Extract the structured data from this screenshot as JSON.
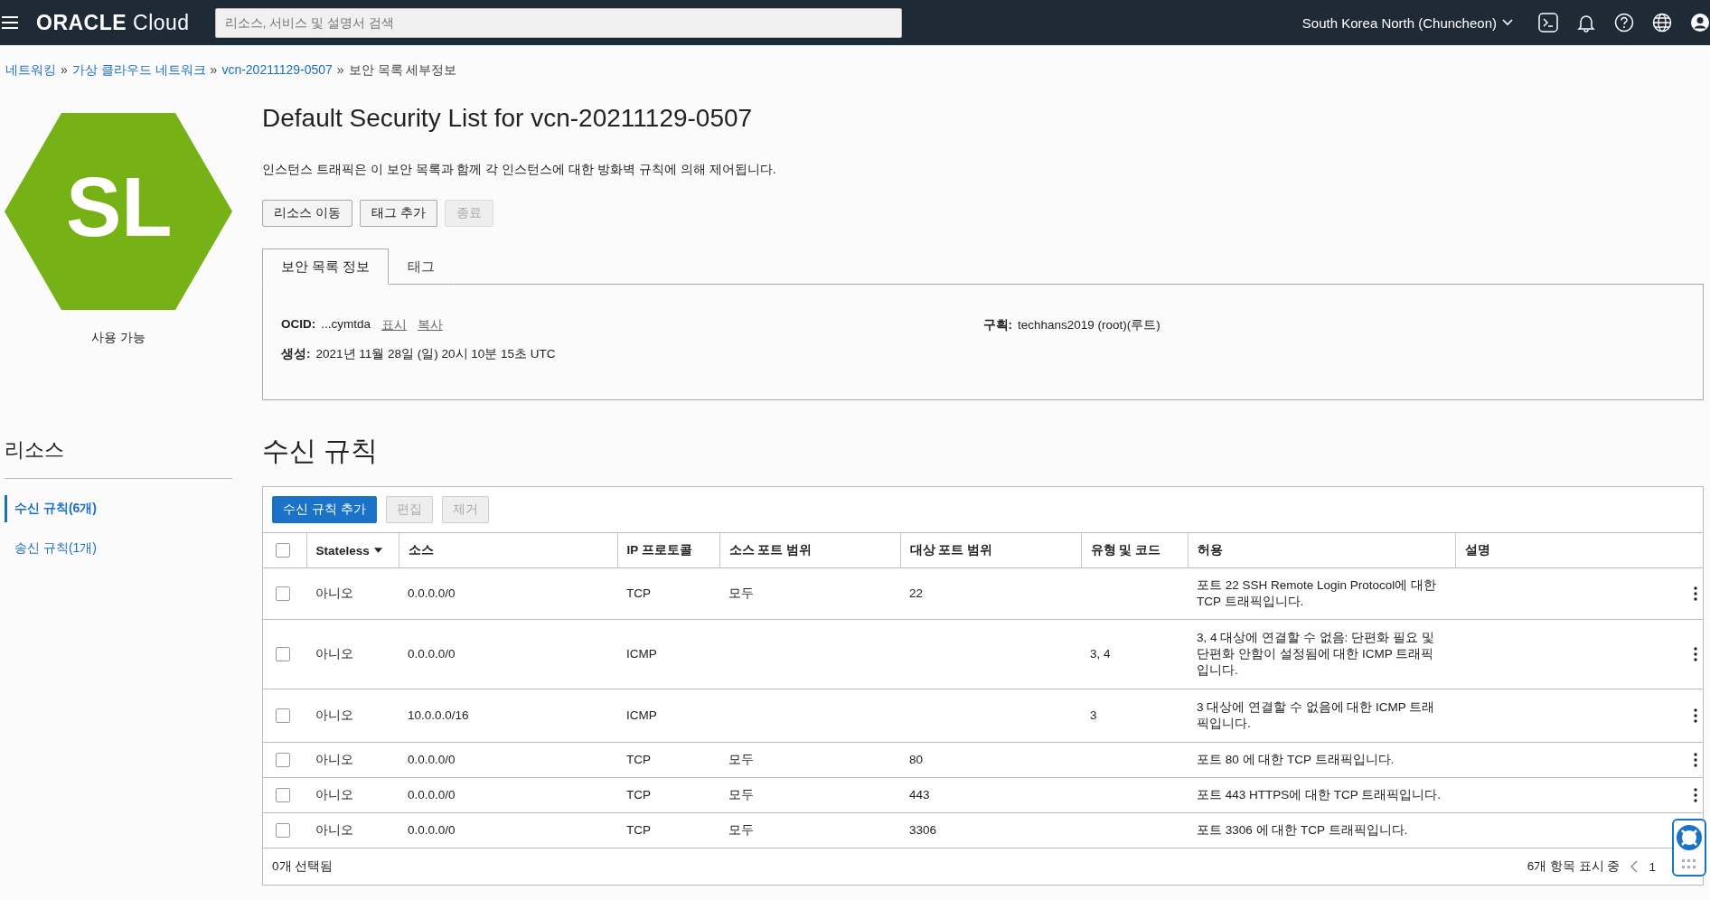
{
  "topbar": {
    "brand": "ORACLE",
    "product": "Cloud",
    "search": {
      "placeholder": "리소스, 서비스 및 설명서 검색"
    },
    "region": "South Korea North (Chuncheon)"
  },
  "breadcrumb": [
    {
      "label": "네트워킹",
      "link": true
    },
    {
      "label": "가상 클라우드 네트워크",
      "link": true
    },
    {
      "label": "vcn-20211129-0507",
      "link": true
    },
    {
      "label": "보안 목록 세부정보",
      "link": false
    }
  ],
  "separator": "»",
  "resource_icon": {
    "initials": "SL",
    "status": "사용 가능"
  },
  "title": "Default Security List for vcn-20211129-0507",
  "description": "인스턴스 트래픽은 이 보안 목록과 함께 각 인스턴스에 대한 방화벽 규칙에 의해 제어됩니다.",
  "actions": [
    {
      "label": "리소스 이동",
      "disabled": false
    },
    {
      "label": "태그 추가",
      "disabled": false
    },
    {
      "label": "종료",
      "disabled": true
    }
  ],
  "tabs": [
    {
      "label": "보안 목록 정보",
      "selected": true
    },
    {
      "label": "태그",
      "selected": false
    }
  ],
  "info": {
    "ocid_label": "OCID:",
    "ocid": "...cymtda",
    "show": "표시",
    "copy": "복사",
    "created_label": "생성:",
    "created": "2021년 11월 28일 (일) 20시 10분 15초 UTC",
    "compartment_label": "구획:",
    "compartment": "techhans2019 (root)(루트)"
  },
  "sidebar": {
    "title": "리소스",
    "items": [
      {
        "label": "수신 규칙",
        "count": "(6개)",
        "selected": true
      },
      {
        "label": "송신 규칙",
        "count": "(1개)",
        "selected": false
      }
    ]
  },
  "section_title": "수신 규칙",
  "toolbar": [
    {
      "label": "수신 규칙 추가",
      "kind": "primary",
      "disabled": false
    },
    {
      "label": "편집",
      "kind": "secondary",
      "disabled": true
    },
    {
      "label": "제거",
      "kind": "secondary",
      "disabled": true
    }
  ],
  "table": {
    "columns": [
      "Stateless",
      "소스",
      "IP 프로토콜",
      "소스 포트 범위",
      "대상 포트 범위",
      "유형 및 코드",
      "허용",
      "설명"
    ],
    "rows": [
      {
        "checked": false,
        "cells": [
          "아니오",
          "0.0.0.0/0",
          "TCP",
          "모두",
          "22",
          "",
          "포트 22 SSH Remote Login Protocol에 대한 TCP 트래픽입니다.",
          ""
        ]
      },
      {
        "checked": false,
        "cells": [
          "아니오",
          "0.0.0.0/0",
          "ICMP",
          "",
          "",
          "3, 4",
          "3, 4 대상에 연결할 수 없음: 단편화 필요 및 단편화 안함이 설정됨에 대한 ICMP 트래픽입니다.",
          ""
        ]
      },
      {
        "checked": false,
        "cells": [
          "아니오",
          "10.0.0.0/16",
          "ICMP",
          "",
          "",
          "3",
          "3 대상에 연결할 수 없음에 대한 ICMP 트래픽입니다.",
          ""
        ]
      },
      {
        "checked": false,
        "cells": [
          "아니오",
          "0.0.0.0/0",
          "TCP",
          "모두",
          "80",
          "",
          "포트 80 에 대한 TCP 트래픽입니다.",
          ""
        ]
      },
      {
        "checked": false,
        "cells": [
          "아니오",
          "0.0.0.0/0",
          "TCP",
          "모두",
          "443",
          "",
          "포트 443 HTTPS에 대한 TCP 트래픽입니다.",
          ""
        ]
      },
      {
        "checked": false,
        "cells": [
          "아니오",
          "0.0.0.0/0",
          "TCP",
          "모두",
          "3306",
          "",
          "포트 3306 에 대한 TCP 트래픽입니다.",
          ""
        ]
      }
    ],
    "select_all_checked": false,
    "selected_count": "0개 선택됨",
    "showing": "6개 항목 표시 중",
    "page": "1"
  }
}
